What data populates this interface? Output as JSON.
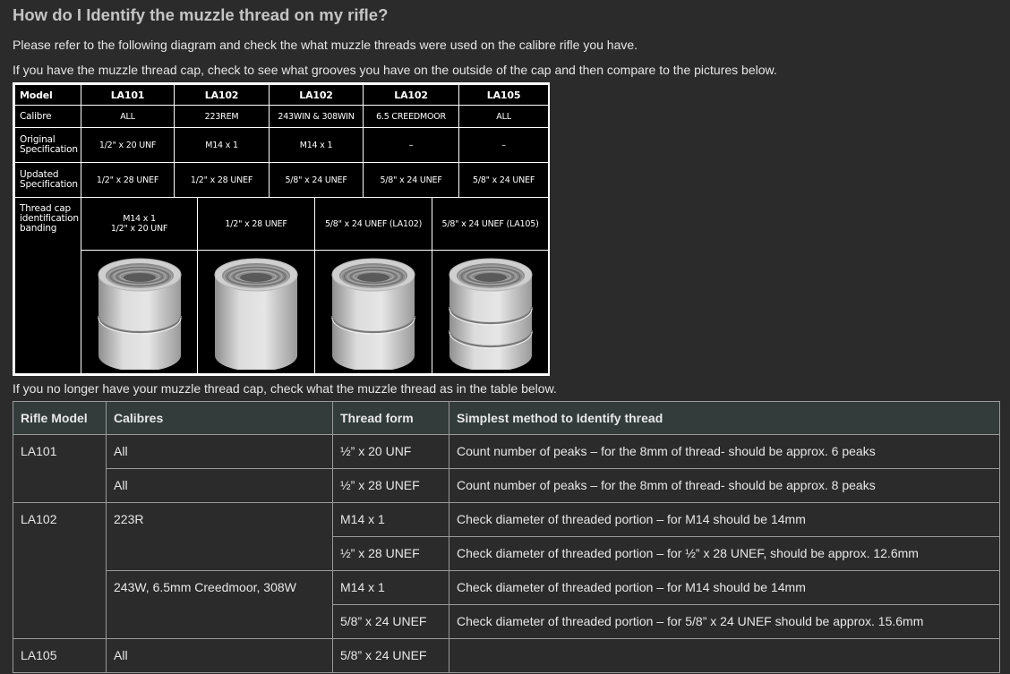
{
  "heading": "How do I Identify the muzzle thread on my rifle?",
  "intro_1": "Please refer to the following diagram and check the what muzzle threads were used on the calibre rifle you have.",
  "intro_2": "If you have the muzzle thread cap, check to see what grooves you have on the outside of the cap and then compare to the pictures below.",
  "intro_3": "If you no longer have your muzzle thread cap, check what the muzzle thread as in the table below.",
  "diagram": {
    "row_labels": {
      "model": "Model",
      "calibre": "Calibre",
      "original_1": "Original",
      "original_2": "Specification",
      "updated_1": "Updated",
      "updated_2": "Specification",
      "band_1": "Thread cap",
      "band_2": "identification",
      "band_3": "banding"
    },
    "models": [
      "LA101",
      "LA102",
      "LA102",
      "LA102",
      "LA105"
    ],
    "calibres": [
      "ALL",
      "223REM",
      "243WIN & 308WIN",
      "6.5 CREEDMOOR",
      "ALL"
    ],
    "original": [
      "1/2\" x 20 UNF",
      "M14 x 1",
      "M14 x 1",
      "–",
      "–"
    ],
    "updated": [
      "1/2\" x 28 UNEF",
      "1/2\" x 28 UNEF",
      "5/8\" x 24 UNEF",
      "5/8\" x 24 UNEF",
      "5/8\" x 24 UNEF"
    ],
    "banding": [
      {
        "line1": "M14 x 1",
        "line2": "1/2\" x 20 UNF"
      },
      {
        "line1": "1/2\" x 28 UNEF",
        "line2": ""
      },
      {
        "line1": "5/8\" x 24 UNEF (LA102)",
        "line2": ""
      },
      {
        "line1": "5/8\" x 24 UNEF (LA105)",
        "line2": ""
      }
    ],
    "caps": [
      {
        "grooves": 1
      },
      {
        "grooves": 0
      },
      {
        "grooves": 1
      },
      {
        "grooves": 2
      }
    ]
  },
  "thread_table": {
    "headers": [
      "Rifle Model",
      "Calibres",
      "Thread form",
      "Simplest method to Identify thread"
    ],
    "rows": [
      {
        "model": "LA101",
        "calibre": "All",
        "thread": "½” x 20 UNF",
        "method": "Count number of peaks – for the 8mm of thread- should be approx. 6 peaks"
      },
      {
        "model": "",
        "calibre": "All",
        "thread": "½” x 28 UNEF",
        "method": "Count number of peaks – for the 8mm of thread- should be approx. 8 peaks"
      },
      {
        "model": "LA102",
        "calibre": "223R",
        "thread": "M14 x 1",
        "method": "Check diameter of threaded portion – for M14 should be 14mm"
      },
      {
        "model": "",
        "calibre": "",
        "thread": "½” x 28 UNEF",
        "method": "Check diameter of threaded portion – for ½” x 28 UNEF, should be approx. 12.6mm"
      },
      {
        "model": "",
        "calibre": "243W, 6.5mm Creedmoor, 308W",
        "thread": "M14 x 1",
        "method": "Check diameter of threaded portion – for M14 should be 14mm"
      },
      {
        "model": "",
        "calibre": "",
        "thread": "5/8” x 24 UNEF",
        "method": "Check diameter of threaded portion – for 5/8” x 24 UNEF should be approx. 15.6mm"
      },
      {
        "model": "LA105",
        "calibre": "All",
        "thread": "5/8” x 24 UNEF",
        "method": ""
      }
    ]
  }
}
